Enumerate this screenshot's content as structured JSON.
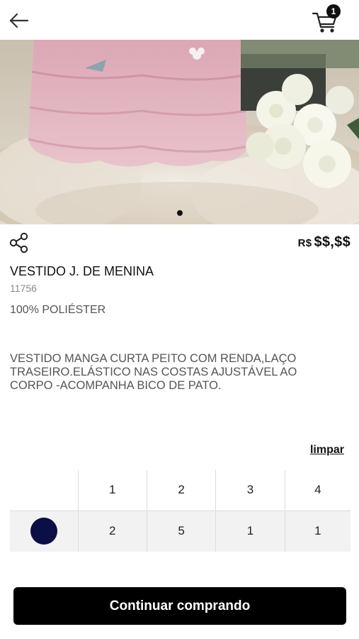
{
  "header": {
    "back_icon": "arrow-left-icon",
    "cart_icon": "shopping-cart-icon",
    "cart_count": "1"
  },
  "gallery": {
    "slide_count": 1,
    "active_index": 0
  },
  "product": {
    "share_icon": "share-icon",
    "currency": "R$",
    "price": "$$,$$",
    "name": "VESTIDO J. DE MENINA",
    "reference": "11756",
    "composition": "100% POLIÉSTER",
    "description": "VESTIDO MANGA CURTA PEITO COM RENDA,LAÇO TRASEIRO.ELÁSTICO NAS COSTAS AJUSTÁVEL AO CORPO -ACOMPANHA BICO DE PATO."
  },
  "selection": {
    "clear_label": "limpar",
    "sizes": [
      "1",
      "2",
      "3",
      "4"
    ],
    "rows": [
      {
        "color": "#0b0f45",
        "quantities": [
          "2",
          "5",
          "1",
          "1"
        ]
      }
    ]
  },
  "actions": {
    "continue_label": "Continuar comprando"
  }
}
